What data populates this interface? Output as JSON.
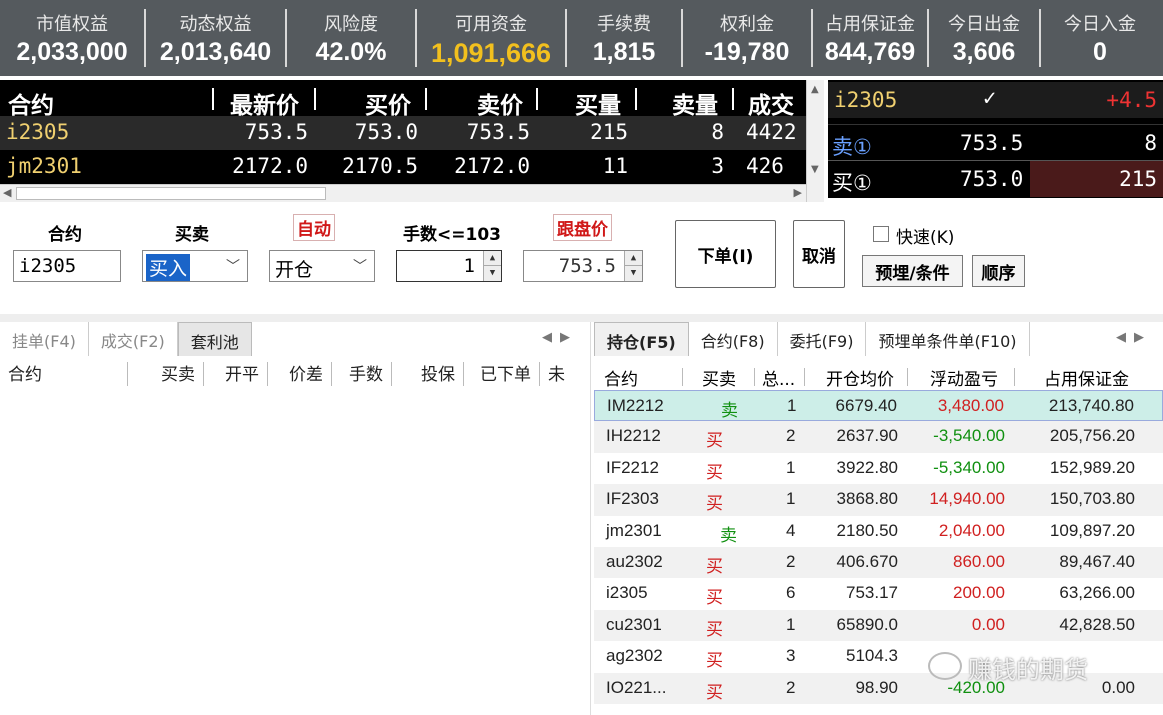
{
  "summary": [
    {
      "label": "市值权益",
      "value": "2,033,000"
    },
    {
      "label": "动态权益",
      "value": "2,013,640"
    },
    {
      "label": "风险度",
      "value": "42.0%"
    },
    {
      "label": "可用资金",
      "value": "1,091,666"
    },
    {
      "label": "手续费",
      "value": "1,815"
    },
    {
      "label": "权利金",
      "value": "-19,780"
    },
    {
      "label": "占用保证金",
      "value": "844,769"
    },
    {
      "label": "今日出金",
      "value": "3,606"
    },
    {
      "label": "今日入金",
      "value": "0"
    }
  ],
  "quote": {
    "headers": [
      "合约",
      "最新价",
      "买价",
      "卖价",
      "买量",
      "卖量",
      "成交"
    ],
    "rows": [
      {
        "symbol": "i2305",
        "last": "753.5",
        "bid": "753.0",
        "ask": "753.5",
        "bid_vol": "215",
        "ask_vol": "8",
        "volume": "4422"
      },
      {
        "symbol": "jm2301",
        "last": "2172.0",
        "bid": "2170.5",
        "ask": "2172.0",
        "bid_vol": "11",
        "ask_vol": "3",
        "volume": "426"
      }
    ]
  },
  "depth": {
    "symbol": "i2305",
    "tick": "✓",
    "change": "+4.5",
    "sell_label": "卖①",
    "sell_price": "753.5",
    "sell_qty": "8",
    "buy_label": "买①",
    "buy_price": "753.0",
    "buy_qty": "215"
  },
  "order": {
    "contract_label": "合约",
    "contract_value": "i2305",
    "side_label": "买卖",
    "side_value": "买入",
    "auto_label": "自动",
    "offset_value": "开仓",
    "lots_label": "手数<=103",
    "lots_value": "1",
    "price_label": "跟盘价",
    "price_value": "753.5",
    "submit_label": "下单(I)",
    "cancel_label": "取消",
    "fast_label": "快速(K)",
    "preset_label": "预埋/条件",
    "sequence_label": "顺序"
  },
  "left_tabs": [
    "挂单(F4)",
    "成交(F2)",
    "套利池"
  ],
  "left_columns": [
    "合约",
    "买卖",
    "开平",
    "价差",
    "手数",
    "投保",
    "已下单",
    "未"
  ],
  "right_tabs": [
    "持仓(F5)",
    "合约(F8)",
    "委托(F9)",
    "预埋单条件单(F10)"
  ],
  "position_columns": [
    "合约",
    "买卖",
    "总...",
    "开仓均价",
    "浮动盈亏",
    "占用保证金"
  ],
  "positions": [
    {
      "symbol": "IM2212",
      "side": "卖",
      "lots": "1",
      "avg": "6679.40",
      "pnl": "3,480.00",
      "margin": "213,740.80"
    },
    {
      "symbol": "IH2212",
      "side": "买",
      "lots": "2",
      "avg": "2637.90",
      "pnl": "-3,540.00",
      "margin": "205,756.20"
    },
    {
      "symbol": "IF2212",
      "side": "买",
      "lots": "1",
      "avg": "3922.80",
      "pnl": "-5,340.00",
      "margin": "152,989.20"
    },
    {
      "symbol": "IF2303",
      "side": "买",
      "lots": "1",
      "avg": "3868.80",
      "pnl": "14,940.00",
      "margin": "150,703.80"
    },
    {
      "symbol": "jm2301",
      "side": "卖",
      "lots": "4",
      "avg": "2180.50",
      "pnl": "2,040.00",
      "margin": "109,897.20"
    },
    {
      "symbol": "au2302",
      "side": "买",
      "lots": "2",
      "avg": "406.670",
      "pnl": "860.00",
      "margin": "89,467.40"
    },
    {
      "symbol": "i2305",
      "side": "买",
      "lots": "6",
      "avg": "753.17",
      "pnl": "200.00",
      "margin": "63,266.00"
    },
    {
      "symbol": "cu2301",
      "side": "买",
      "lots": "1",
      "avg": "65890.0",
      "pnl": "0.00",
      "margin": "42,828.50"
    },
    {
      "symbol": "ag2302",
      "side": "买",
      "lots": "3",
      "avg": "5104.3",
      "pnl": "",
      "margin": ""
    },
    {
      "symbol": "IO221...",
      "side": "买",
      "lots": "2",
      "avg": "98.90",
      "pnl": "-420.00",
      "margin": "0.00"
    }
  ],
  "watermark": "赚钱的期货"
}
